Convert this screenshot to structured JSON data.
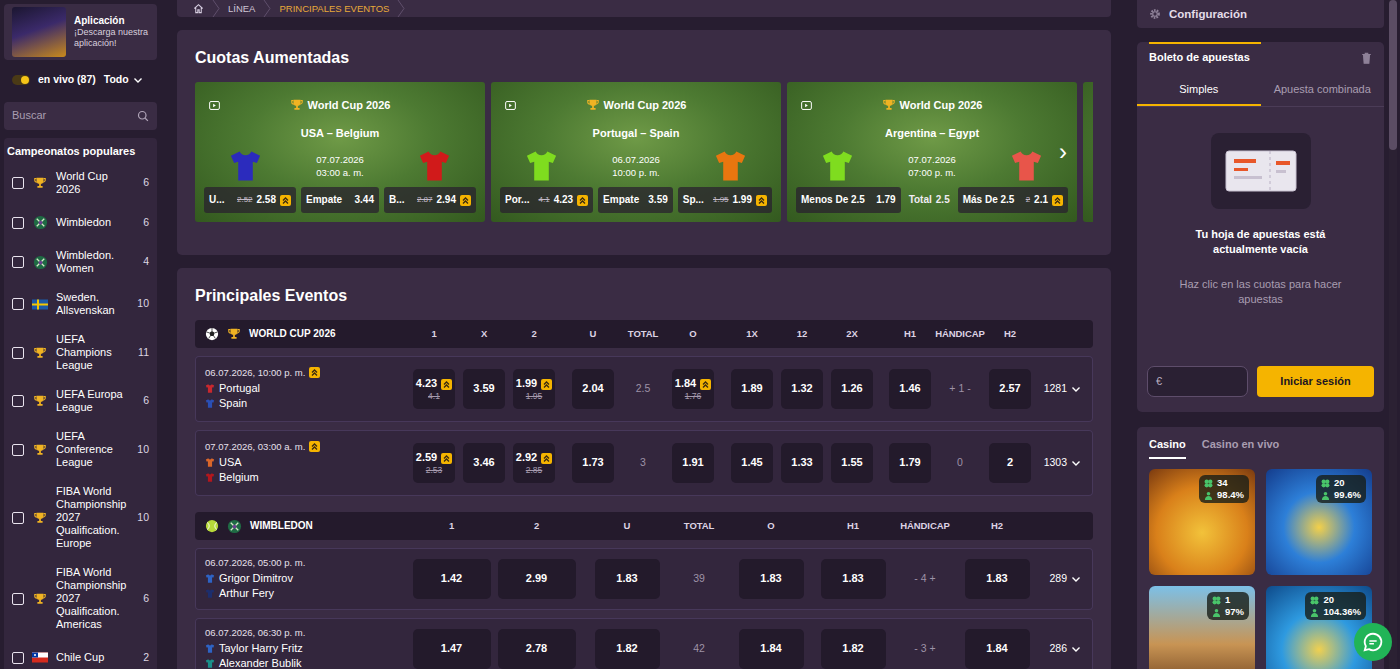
{
  "app_promo": {
    "title": "Aplicación",
    "subtitle": "¡Descarga nuestra aplicación!"
  },
  "live": {
    "on": true,
    "label": "en vivo (87)",
    "filter": "Todo"
  },
  "search": {
    "placeholder": "Buscar"
  },
  "sidebar": {
    "heading": "Campeonatos populares",
    "items": [
      {
        "label": "World Cup 2026",
        "count": "6",
        "kind": "trophy",
        "checked": false
      },
      {
        "label": "Wimbledon",
        "count": "6",
        "kind": "tennis",
        "checked": false
      },
      {
        "label": "Wimbledon. Women",
        "count": "4",
        "kind": "tennis",
        "checked": false
      },
      {
        "label": "Sweden. Allsvenskan",
        "count": "10",
        "kind": "flag-se",
        "checked": false
      },
      {
        "label": "UEFA Champions League",
        "count": "11",
        "kind": "trophy",
        "checked": false
      },
      {
        "label": "UEFA Europa League",
        "count": "6",
        "kind": "trophy",
        "checked": false
      },
      {
        "label": "UEFA Conference League",
        "count": "10",
        "kind": "trophy",
        "checked": false
      },
      {
        "label": "FIBA World Championship 2027 Qualification. Europe",
        "count": "10",
        "kind": "trophy",
        "checked": false
      },
      {
        "label": "FIBA World Championship 2027 Qualification. Americas",
        "count": "6",
        "kind": "trophy",
        "checked": false
      },
      {
        "label": "Chile Cup",
        "count": "2",
        "kind": "flag-cl",
        "checked": false
      }
    ]
  },
  "breadcrumb": [
    {
      "label": "LÍNEA",
      "selected": false
    },
    {
      "label": "PRINCIPALES EVENTOS",
      "selected": true
    }
  ],
  "boosted": {
    "title": "Cuotas Aumentadas",
    "next": "›",
    "cards": [
      {
        "competition": "World Cup 2026",
        "match": "USA – Belgium",
        "date": "07.07.2026",
        "time": "03:00 a. m.",
        "home_color": "#2b2bbd",
        "away_color": "#d11a1a",
        "odds": [
          {
            "kind": "odd",
            "label": "U...",
            "old": "2.52",
            "value": "2.58",
            "boosted": true
          },
          {
            "kind": "odd",
            "label": "Empate",
            "value": "3.44",
            "boosted": false
          },
          {
            "kind": "odd",
            "label": "B...",
            "old": "2.87",
            "value": "2.94",
            "boosted": true
          }
        ]
      },
      {
        "competition": "World Cup 2026",
        "match": "Portugal – Spain",
        "date": "06.07.2026",
        "time": "10:00 p. m.",
        "home_color": "#7fdc1f",
        "away_color": "#e9760f",
        "odds": [
          {
            "kind": "odd",
            "label": "Por...",
            "old": "4.1",
            "value": "4.23",
            "boosted": true
          },
          {
            "kind": "odd",
            "label": "Empate",
            "value": "3.59",
            "boosted": false
          },
          {
            "kind": "odd",
            "label": "Sp...",
            "old": "1.95",
            "value": "1.99",
            "boosted": true
          }
        ]
      },
      {
        "competition": "World Cup 2026",
        "match": "Argentina – Egypt",
        "date": "07.07.2026",
        "time": "07:00 p. m.",
        "home_color": "#7fdc1f",
        "away_color": "#e8554a",
        "odds": [
          {
            "kind": "odd",
            "label": "Menos De 2.5",
            "value": "1.79",
            "boosted": false
          },
          {
            "kind": "line",
            "label": "Total",
            "value": "2.5"
          },
          {
            "kind": "odd",
            "label": "Más De 2.5",
            "old": "2",
            "value": "2.1",
            "boosted": true
          }
        ]
      }
    ]
  },
  "events": {
    "title": "Principales Eventos",
    "groups": [
      {
        "kind": "football",
        "name": "WORLD CUP 2026",
        "columns": [
          "1",
          "X",
          "2",
          "U",
          "TOTAL",
          "O",
          "1X",
          "12",
          "2X",
          "H1",
          "HÁNDICAP",
          "H2"
        ],
        "rows": [
          {
            "datetime": "06.07.2026, 10:00 p. m.",
            "boosted": true,
            "teams": [
              {
                "name": "Portugal",
                "color": "#c8282e"
              },
              {
                "name": "Spain",
                "color": "#2a4fb5"
              }
            ],
            "cells": [
              {
                "kind": "odd",
                "value": "4.23",
                "old": "4.1",
                "boosted": true
              },
              {
                "kind": "odd",
                "value": "3.59",
                "boosted": false
              },
              {
                "kind": "odd",
                "value": "1.99",
                "old": "1.95",
                "boosted": true
              },
              {
                "kind": "odd",
                "value": "2.04",
                "boosted": false
              },
              {
                "kind": "line",
                "value": "2.5"
              },
              {
                "kind": "odd",
                "value": "1.84",
                "old": "1.76",
                "boosted": true
              },
              {
                "kind": "odd",
                "value": "1.89",
                "boosted": false
              },
              {
                "kind": "odd",
                "value": "1.32",
                "boosted": false
              },
              {
                "kind": "odd",
                "value": "1.26",
                "boosted": false
              },
              {
                "kind": "odd",
                "value": "1.46",
                "boosted": false
              },
              {
                "kind": "line",
                "value": "+ 1 -"
              },
              {
                "kind": "odd",
                "value": "2.57",
                "boosted": false
              }
            ],
            "more": "1281"
          },
          {
            "datetime": "07.07.2026, 03:00 a. m.",
            "boosted": true,
            "teams": [
              {
                "name": "USA",
                "color": "#d9662a"
              },
              {
                "name": "Belgium",
                "color": "#b3171d"
              }
            ],
            "cells": [
              {
                "kind": "odd",
                "value": "2.59",
                "old": "2.53",
                "boosted": true
              },
              {
                "kind": "odd",
                "value": "3.46",
                "boosted": false
              },
              {
                "kind": "odd",
                "value": "2.92",
                "old": "2.85",
                "boosted": true
              },
              {
                "kind": "odd",
                "value": "1.73",
                "boosted": false
              },
              {
                "kind": "line",
                "value": "3"
              },
              {
                "kind": "odd",
                "value": "1.91",
                "boosted": false
              },
              {
                "kind": "odd",
                "value": "1.45",
                "boosted": false
              },
              {
                "kind": "odd",
                "value": "1.33",
                "boosted": false
              },
              {
                "kind": "odd",
                "value": "1.55",
                "boosted": false
              },
              {
                "kind": "odd",
                "value": "1.79",
                "boosted": false
              },
              {
                "kind": "line",
                "value": "0"
              },
              {
                "kind": "odd",
                "value": "2",
                "boosted": false
              }
            ],
            "more": "1303"
          }
        ]
      },
      {
        "kind": "tennis",
        "name": "WIMBLEDON",
        "columns": [
          "1",
          "2",
          "U",
          "TOTAL",
          "O",
          "H1",
          "HÁNDICAP",
          "H2"
        ],
        "rows": [
          {
            "datetime": "06.07.2026, 05:00 p. m.",
            "boosted": false,
            "teams": [
              {
                "name": "Grigor Dimitrov",
                "color": "#2e63c4"
              },
              {
                "name": "Arthur Fery",
                "color": "#1c2e6e"
              }
            ],
            "cells": [
              {
                "kind": "odd",
                "value": "1.42",
                "boosted": false
              },
              {
                "kind": "odd",
                "value": "2.99",
                "boosted": false
              },
              {
                "kind": "odd",
                "value": "1.83",
                "boosted": false
              },
              {
                "kind": "line",
                "value": "39"
              },
              {
                "kind": "odd",
                "value": "1.83",
                "boosted": false
              },
              {
                "kind": "odd",
                "value": "1.83",
                "boosted": false
              },
              {
                "kind": "line",
                "value": "- 4 +"
              },
              {
                "kind": "odd",
                "value": "1.83",
                "boosted": false
              }
            ],
            "more": "289"
          },
          {
            "datetime": "06.07.2026, 06:30 p. m.",
            "boosted": false,
            "teams": [
              {
                "name": "Taylor Harry Fritz",
                "color": "#2e63c4"
              },
              {
                "name": "Alexander Bublik",
                "color": "#1a8f8a"
              }
            ],
            "cells": [
              {
                "kind": "odd",
                "value": "1.47",
                "boosted": false
              },
              {
                "kind": "odd",
                "value": "2.78",
                "boosted": false
              },
              {
                "kind": "odd",
                "value": "1.82",
                "boosted": false
              },
              {
                "kind": "line",
                "value": "42"
              },
              {
                "kind": "odd",
                "value": "1.84",
                "boosted": false
              },
              {
                "kind": "odd",
                "value": "1.82",
                "boosted": false
              },
              {
                "kind": "line",
                "value": "- 3 +"
              },
              {
                "kind": "odd",
                "value": "1.84",
                "boosted": false
              }
            ],
            "more": "286"
          }
        ]
      }
    ]
  },
  "settings": {
    "label": "Configuración"
  },
  "bet_slip": {
    "title": "Boleto de apuestas",
    "tabs": [
      {
        "label": "Simples",
        "selected": true
      },
      {
        "label": "Apuesta combinada",
        "selected": false
      }
    ],
    "empty_title": "Tu hoja de apuestas está actualmente vacía",
    "empty_hint": "Haz clic en las cuotas para hacer apuestas",
    "currency": "€",
    "login": "Iniciar sesión"
  },
  "casino": {
    "tabs": [
      {
        "label": "Casino",
        "selected": true
      },
      {
        "label": "Casino en vivo",
        "selected": false
      }
    ],
    "games": [
      {
        "players": "34",
        "rtp": "98.4%"
      },
      {
        "players": "20",
        "rtp": "99.6%"
      },
      {
        "players": "1",
        "rtp": "97%"
      },
      {
        "players": "20",
        "rtp": "104.36%"
      }
    ]
  }
}
